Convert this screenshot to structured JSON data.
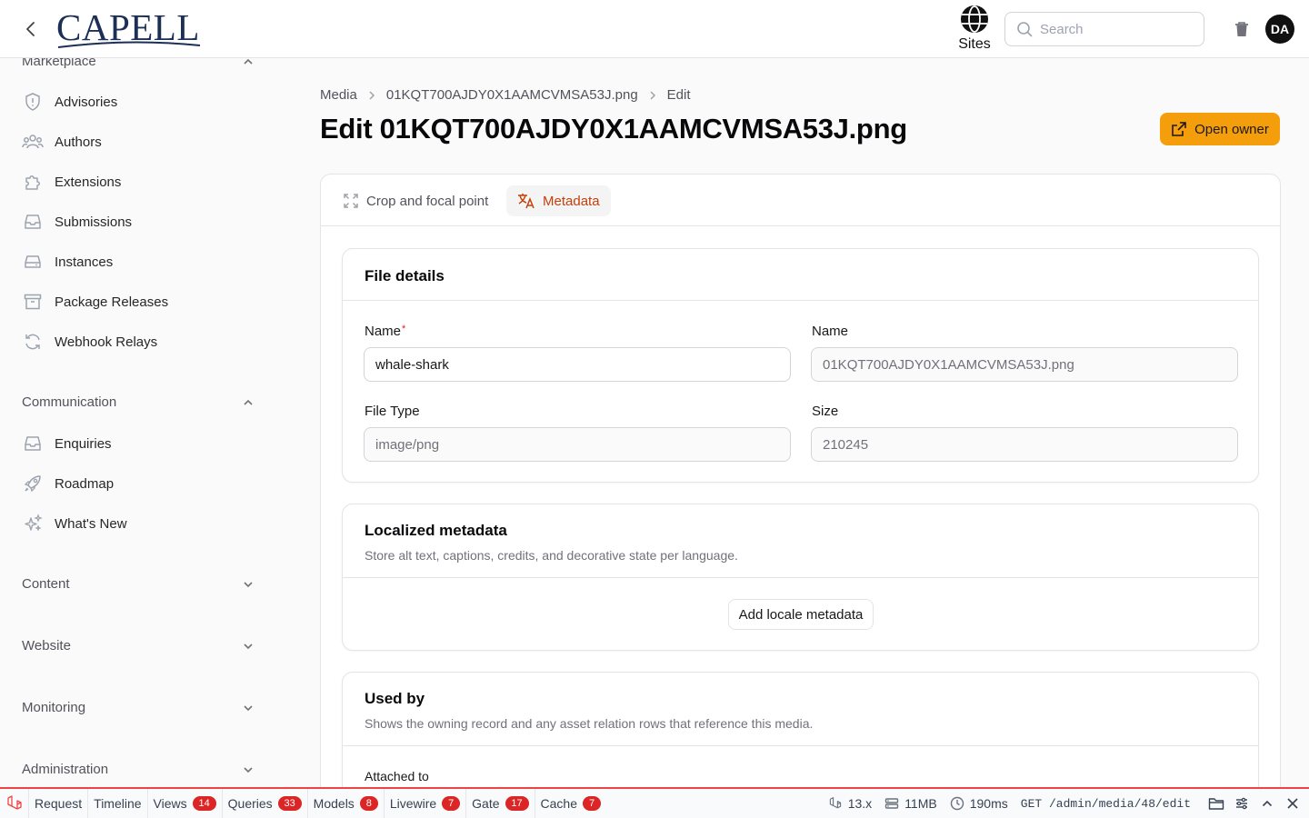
{
  "topbar": {
    "logo_text": "CAPELL",
    "sites_label": "Sites",
    "search_placeholder": "Search",
    "avatar_initials": "DA"
  },
  "sidebar": {
    "marketplace": {
      "label": "Marketplace",
      "items": [
        {
          "label": "Advisories",
          "icon": "shield-icon"
        },
        {
          "label": "Authors",
          "icon": "users-icon"
        },
        {
          "label": "Extensions",
          "icon": "puzzle-icon"
        },
        {
          "label": "Submissions",
          "icon": "inbox-icon"
        },
        {
          "label": "Instances",
          "icon": "server-icon"
        },
        {
          "label": "Package Releases",
          "icon": "archive-icon"
        },
        {
          "label": "Webhook Relays",
          "icon": "refresh-icon"
        }
      ]
    },
    "communication": {
      "label": "Communication",
      "items": [
        {
          "label": "Enquiries",
          "icon": "inbox-icon"
        },
        {
          "label": "Roadmap",
          "icon": "rocket-icon"
        },
        {
          "label": "What's New",
          "icon": "sparkles-icon"
        }
      ]
    },
    "collapsed_groups": [
      "Content",
      "Website",
      "Monitoring",
      "Administration"
    ]
  },
  "breadcrumb": [
    "Media",
    "01KQT700AJDY0X1AAMCVMSA53J.png",
    "Edit"
  ],
  "page": {
    "title": "Edit 01KQT700AJDY0X1AAMCVMSA53J.png",
    "open_owner_label": "Open owner"
  },
  "tabs": [
    {
      "label": "Crop and focal point",
      "active": false
    },
    {
      "label": "Metadata",
      "active": true
    }
  ],
  "file_details": {
    "title": "File details",
    "name_label": "Name",
    "name_value": "whale-shark",
    "filename_label": "Name",
    "filename_value": "01KQT700AJDY0X1AAMCVMSA53J.png",
    "filetype_label": "File Type",
    "filetype_value": "image/png",
    "size_label": "Size",
    "size_value": "210245"
  },
  "localized": {
    "title": "Localized metadata",
    "description": "Store alt text, captions, credits, and decorative state per language.",
    "add_label": "Add locale metadata"
  },
  "used_by": {
    "title": "Used by",
    "description": "Shows the owning record and any asset relation rows that reference this media.",
    "attached_label": "Attached to"
  },
  "debugbar": {
    "tabs": [
      {
        "label": "Request",
        "count": ""
      },
      {
        "label": "Timeline",
        "count": ""
      },
      {
        "label": "Views",
        "count": "14"
      },
      {
        "label": "Queries",
        "count": "33"
      },
      {
        "label": "Models",
        "count": "8"
      },
      {
        "label": "Livewire",
        "count": "7"
      },
      {
        "label": "Gate",
        "count": "17"
      },
      {
        "label": "Cache",
        "count": "7"
      }
    ],
    "version": "13.x",
    "memory": "11MB",
    "time": "190ms",
    "route": "GET /admin/media/48/edit"
  },
  "colors": {
    "accent": "#f59e0b",
    "active_tab_text": "#c2410c",
    "debug_red": "#dc2626",
    "logo_navy": "#1c2f56"
  }
}
